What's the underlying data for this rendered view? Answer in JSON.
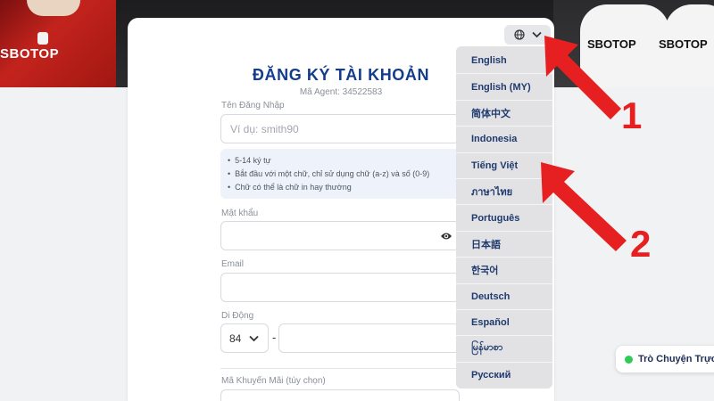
{
  "banner": {
    "left_sponsor": "SBOTOP",
    "right_sponsor_1": "SBOTOP",
    "right_sponsor_2": "SBOTOP"
  },
  "form": {
    "title": "ĐĂNG KÝ TÀI KHOẢN",
    "agent_code": "Mã Agent: 34522583",
    "username_label": "Tên Đăng Nhập",
    "username_placeholder": "Ví dụ: smith90",
    "username_hints": [
      "5-14 ký tự",
      "Bắt đầu với một chữ, chỉ sử dụng chữ (a-z) và số (0-9)",
      "Chữ có thể là chữ in hay thường"
    ],
    "password_label": "Mật khẩu",
    "email_label": "Email",
    "phone_label": "Di Động",
    "phone_country_code": "84",
    "phone_separator": "-",
    "promo_label": "Mã Khuyến Mãi (tùy chọn)"
  },
  "language_menu": {
    "items": [
      "English",
      "English (MY)",
      "简体中文",
      "Indonesia",
      "Tiếng Việt",
      "ภาษาไทย",
      "Português",
      "日本語",
      "한국어",
      "Deutsch",
      "Español",
      "မြန်မာစာ",
      "Русский"
    ]
  },
  "annotations": {
    "step_1": "1",
    "step_2": "2",
    "arrow_color": "#e62020"
  },
  "chat": {
    "label": "Trò Chuyện Trực"
  },
  "colors": {
    "title": "#143c8c",
    "menu_text": "#1f3a6e",
    "chat_online": "#2ecc55"
  },
  "icons": [
    "globe-icon",
    "chevron-down-icon",
    "eye-icon"
  ]
}
